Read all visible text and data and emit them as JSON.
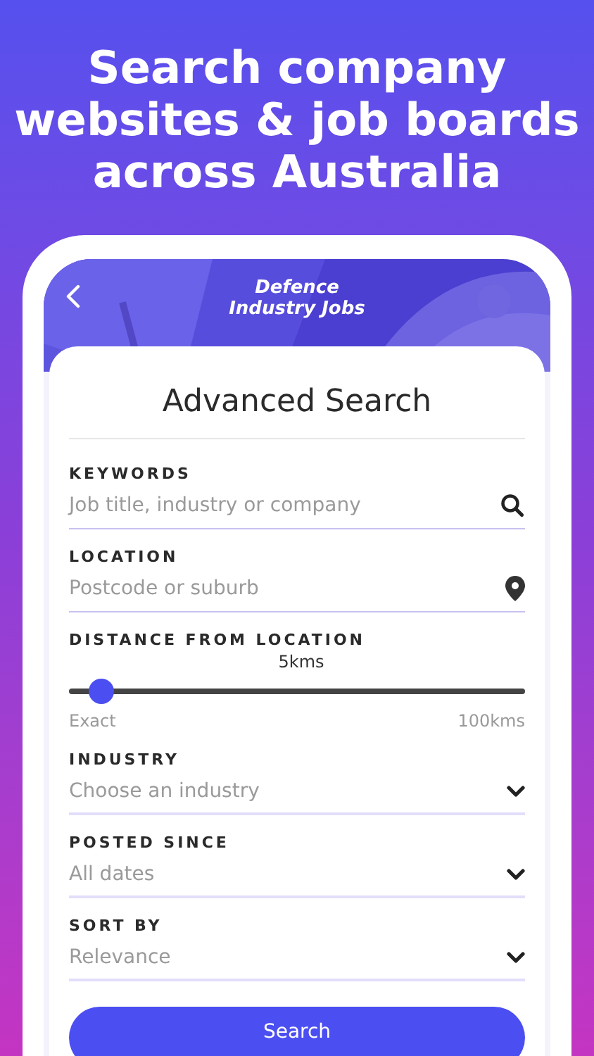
{
  "headline": "Search company\nwebsites & job boards\nacross Australia",
  "app_header": {
    "logo_lines": [
      "Defence",
      "Industry Jobs"
    ]
  },
  "form": {
    "title": "Advanced Search",
    "fields": [
      {
        "kind": "search",
        "label": "KEYWORDS",
        "placeholder": "Job title, industry or company"
      },
      {
        "kind": "location",
        "label": "LOCATION",
        "placeholder": "Postcode or suburb"
      },
      {
        "kind": "slider",
        "label": "DISTANCE FROM LOCATION",
        "reading": "5kms",
        "level": 0.07,
        "min_label": "Exact",
        "max_label": "100kms"
      },
      {
        "kind": "select",
        "label": "INDUSTRY",
        "value": "Choose an industry"
      },
      {
        "kind": "select",
        "label": "POSTED SINCE",
        "value": "All dates"
      },
      {
        "kind": "select",
        "label": "SORT BY",
        "value": "Relevance"
      }
    ],
    "submit": "Search"
  }
}
